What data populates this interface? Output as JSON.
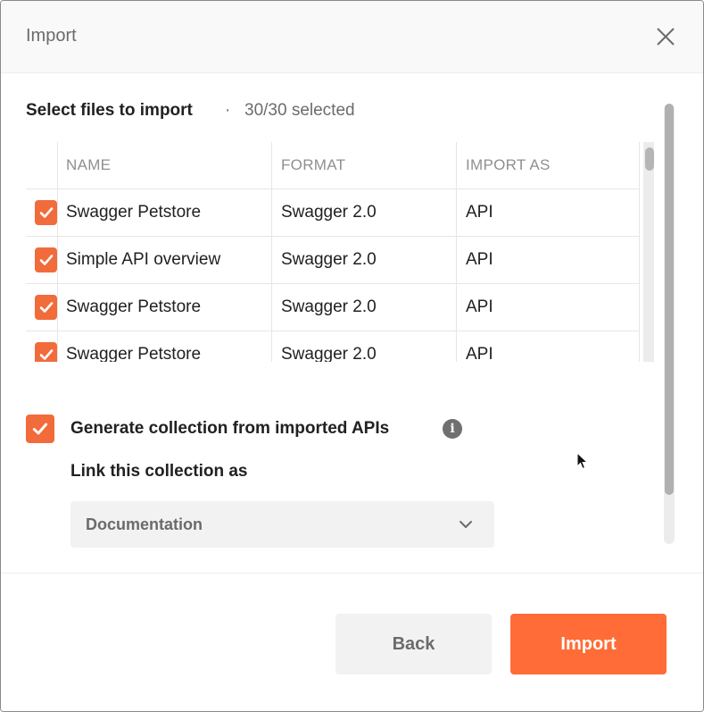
{
  "dialog": {
    "title": "Import"
  },
  "selection": {
    "heading": "Select files to import",
    "separator": "·",
    "count": "30/30 selected"
  },
  "table": {
    "columns": [
      "NAME",
      "FORMAT",
      "IMPORT AS"
    ],
    "rows": [
      {
        "name": "Swagger Petstore",
        "format": "Swagger 2.0",
        "import_as": "API",
        "checked": true
      },
      {
        "name": "Simple API overview",
        "format": "Swagger 2.0",
        "import_as": "API",
        "checked": true
      },
      {
        "name": "Swagger Petstore",
        "format": "Swagger 2.0",
        "import_as": "API",
        "checked": true
      },
      {
        "name": "Swagger Petstore",
        "format": "Swagger 2.0",
        "import_as": "API",
        "checked": true
      }
    ]
  },
  "generate": {
    "label": "Generate collection from imported APIs",
    "checked": true,
    "info_icon": "i"
  },
  "link": {
    "label": "Link this collection as",
    "selected": "Documentation"
  },
  "footer": {
    "back_label": "Back",
    "import_label": "Import"
  },
  "colors": {
    "accent": "#ff6c37",
    "checkbox": "#f26b3a"
  }
}
